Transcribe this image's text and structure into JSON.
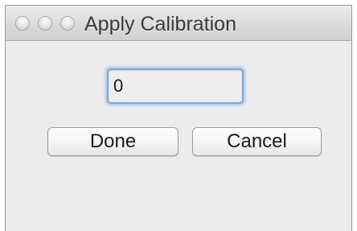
{
  "window": {
    "title": "Apply Calibration",
    "controls": [
      "close-icon",
      "minimize-icon",
      "zoom-icon"
    ]
  },
  "form": {
    "value": "0"
  },
  "buttons": {
    "done_label": "Done",
    "cancel_label": "Cancel"
  },
  "colors": {
    "focus_ring": "#7aa7dd",
    "window_bg": "#ececec"
  }
}
